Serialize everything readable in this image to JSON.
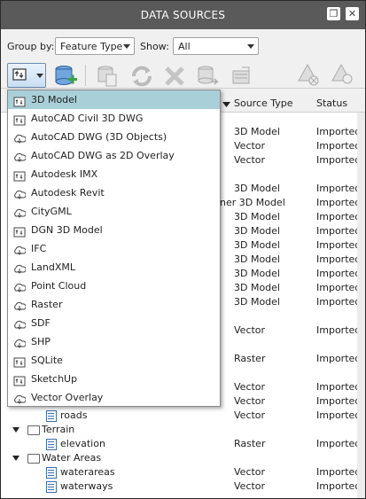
{
  "window": {
    "title": "DATA SOURCES",
    "restore_icon": "restore-window-icon",
    "close_icon": "close-icon"
  },
  "toolbar": {
    "group_by_label": "Group by:",
    "group_by_value": "Feature Type",
    "show_label": "Show:",
    "show_value": "All"
  },
  "columns": {
    "source_type": "Source Type",
    "status": "Status"
  },
  "tree_rows": [
    {
      "name": "",
      "type": "3D Model",
      "status": "Imported"
    },
    {
      "name": "",
      "type": "Vector",
      "status": "Imported"
    },
    {
      "name": "",
      "type": "Vector",
      "status": "Imported"
    },
    {
      "name": "",
      "type": "3D Model",
      "status": "Imported"
    },
    {
      "name": "",
      "type": "ner 3D Model",
      "status": "Imported"
    },
    {
      "name": "",
      "type": "3D Model",
      "status": "Imported"
    },
    {
      "name": "",
      "type": "3D Model",
      "status": "Imported"
    },
    {
      "name": "",
      "type": "3D Model",
      "status": "Imported"
    },
    {
      "name": "",
      "type": "3D Model",
      "status": "Imported"
    },
    {
      "name": "",
      "type": "3D Model",
      "status": "Imported"
    },
    {
      "name": "",
      "type": "3D Model",
      "status": "Imported"
    },
    {
      "name": "",
      "type": "3D Model",
      "status": "Imported"
    },
    {
      "name": "",
      "type": "Vector",
      "status": "Imported"
    },
    {
      "name": "",
      "type": "Raster",
      "status": "Imported"
    },
    {
      "name": "",
      "type": "Vector",
      "status": "Imported"
    },
    {
      "name": "",
      "type": "Vector",
      "status": "Imported"
    },
    {
      "name": "roads",
      "type": "Vector",
      "status": "Imported"
    },
    {
      "name": "Terrain",
      "type": "",
      "status": ""
    },
    {
      "name": "elevation",
      "type": "Raster",
      "status": "Imported"
    },
    {
      "name": "Water Areas",
      "type": "",
      "status": ""
    },
    {
      "name": "waterareas",
      "type": "Vector",
      "status": "Imported"
    },
    {
      "name": "waterways",
      "type": "Vector",
      "status": "Imported"
    }
  ],
  "dropdown_items": [
    {
      "label": "3D Model",
      "selected": true
    },
    {
      "label": "AutoCAD Civil 3D DWG"
    },
    {
      "label": "AutoCAD DWG (3D Objects)"
    },
    {
      "label": "AutoCAD DWG as 2D Overlay"
    },
    {
      "label": "Autodesk IMX"
    },
    {
      "label": "Autodesk Revit"
    },
    {
      "label": "CityGML"
    },
    {
      "label": "DGN 3D Model"
    },
    {
      "label": "IFC"
    },
    {
      "label": "LandXML"
    },
    {
      "label": "Point Cloud"
    },
    {
      "label": "Raster"
    },
    {
      "label": "SDF"
    },
    {
      "label": "SHP"
    },
    {
      "label": "SQLite"
    },
    {
      "label": "SketchUp"
    },
    {
      "label": "Vector Overlay"
    }
  ]
}
